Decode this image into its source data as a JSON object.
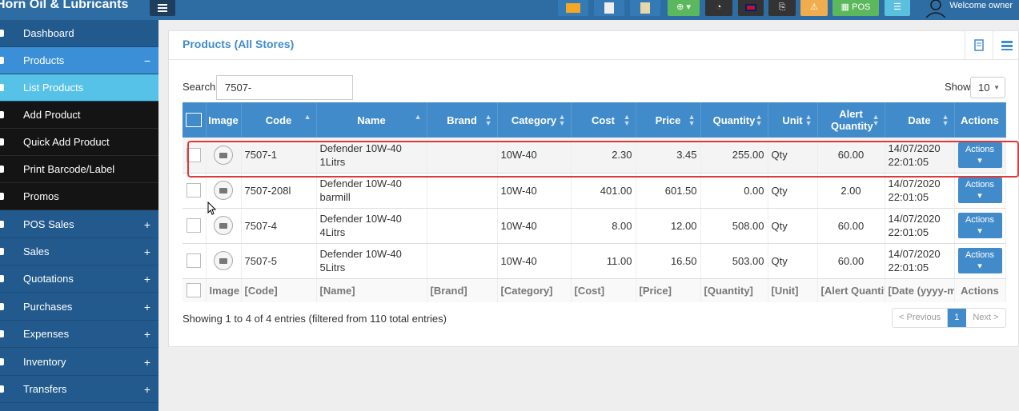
{
  "app": {
    "brand": "Horn Oil & Lubricants",
    "welcome": "Welcome owner",
    "pos_label": "POS"
  },
  "colors": {
    "topbar": "#2e6da4",
    "sidebar": "#235a8e",
    "accent": "#428bca",
    "highlight_box": "#e03838"
  },
  "sidebar": {
    "items": [
      {
        "label": "Dashboard",
        "sign": ""
      },
      {
        "label": "Products",
        "sign": "−"
      },
      {
        "label": "List Products",
        "sign": ""
      },
      {
        "label": "Add Product",
        "sign": ""
      },
      {
        "label": "Quick Add Product",
        "sign": ""
      },
      {
        "label": "Print Barcode/Label",
        "sign": ""
      },
      {
        "label": "Promos",
        "sign": ""
      },
      {
        "label": "POS Sales",
        "sign": "+"
      },
      {
        "label": "Sales",
        "sign": "+"
      },
      {
        "label": "Quotations",
        "sign": "+"
      },
      {
        "label": "Purchases",
        "sign": "+"
      },
      {
        "label": "Expenses",
        "sign": "+"
      },
      {
        "label": "Inventory",
        "sign": "+"
      },
      {
        "label": "Transfers",
        "sign": "+"
      }
    ]
  },
  "page": {
    "title": "Products (All Stores)"
  },
  "search": {
    "label": "Search",
    "value": "7507-"
  },
  "show": {
    "label": "Show",
    "value": "10"
  },
  "table": {
    "headers": [
      "Image",
      "Code",
      "Name",
      "Brand",
      "Category",
      "Cost",
      "Price",
      "Quantity",
      "Unit",
      "Alert Quantity",
      "Date",
      "Actions"
    ],
    "rows": [
      {
        "code": "7507-1",
        "name": "Defender 10W-40 1Litrs",
        "brand": "",
        "category": "10W-40",
        "cost": "2.30",
        "price": "3.45",
        "quantity": "255.00",
        "unit": "Qty",
        "alert": "60.00",
        "date": "14/07/2020 22:01:05",
        "action": "Actions"
      },
      {
        "code": "7507-208l",
        "name": "Defender 10W-40 barmill",
        "brand": "",
        "category": "10W-40",
        "cost": "401.00",
        "price": "601.50",
        "quantity": "0.00",
        "unit": "Qty",
        "alert": "2.00",
        "date": "14/07/2020 22:01:05",
        "action": "Actions"
      },
      {
        "code": "7507-4",
        "name": "Defender 10W-40 4Litrs",
        "brand": "",
        "category": "10W-40",
        "cost": "8.00",
        "price": "12.00",
        "quantity": "508.00",
        "unit": "Qty",
        "alert": "60.00",
        "date": "14/07/2020 22:01:05",
        "action": "Actions"
      },
      {
        "code": "7507-5",
        "name": "Defender 10W-40 5Litrs",
        "brand": "",
        "category": "10W-40",
        "cost": "11.00",
        "price": "16.50",
        "quantity": "503.00",
        "unit": "Qty",
        "alert": "60.00",
        "date": "14/07/2020 22:01:05",
        "action": "Actions"
      }
    ],
    "footer": [
      "Image",
      "[Code]",
      "[Name]",
      "[Brand]",
      "[Category]",
      "[Cost]",
      "[Price]",
      "[Quantity]",
      "[Unit]",
      "[Alert Quantit",
      "[Date (yyyy-m",
      "Actions"
    ]
  },
  "info": "Showing 1 to 4 of 4 entries (filtered from 110 total entries)",
  "pager": {
    "prev": "< Previous",
    "current": "1",
    "next": "Next >"
  }
}
